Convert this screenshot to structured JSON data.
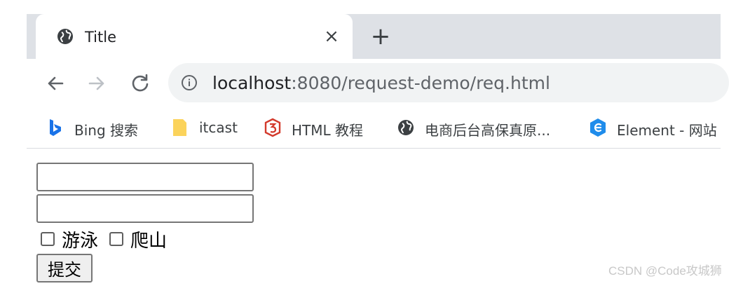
{
  "tab": {
    "title": "Title",
    "close": "×"
  },
  "new_tab": "+",
  "toolbar": {
    "back": "←",
    "forward": "→",
    "reload": "C"
  },
  "omnibox": {
    "host": "localhost",
    "rest": ":8080/request-demo/req.html"
  },
  "bookmarks": [
    {
      "label": "Bing 搜索",
      "icon": "bing-icon"
    },
    {
      "label": "itcast",
      "icon": "folder-icon"
    },
    {
      "label": "HTML 教程",
      "icon": "runoob-icon"
    },
    {
      "label": "电商后台高保真原...",
      "icon": "globe-icon"
    },
    {
      "label": "Element - 网站",
      "icon": "element-icon"
    }
  ],
  "form": {
    "field1_value": "",
    "field2_value": "",
    "checkboxes": [
      {
        "label": "游泳",
        "checked": false
      },
      {
        "label": "爬山",
        "checked": false
      }
    ],
    "submit": "提交"
  },
  "watermark": "CSDN @Code攻城狮",
  "colors": {
    "tabstrip": "#dee1e6",
    "omnibox": "#f1f3f4",
    "bing": "#1a73e8",
    "folder": "#fbd35b",
    "runoob": "#d33a2c",
    "element": "#1f8ceb"
  }
}
